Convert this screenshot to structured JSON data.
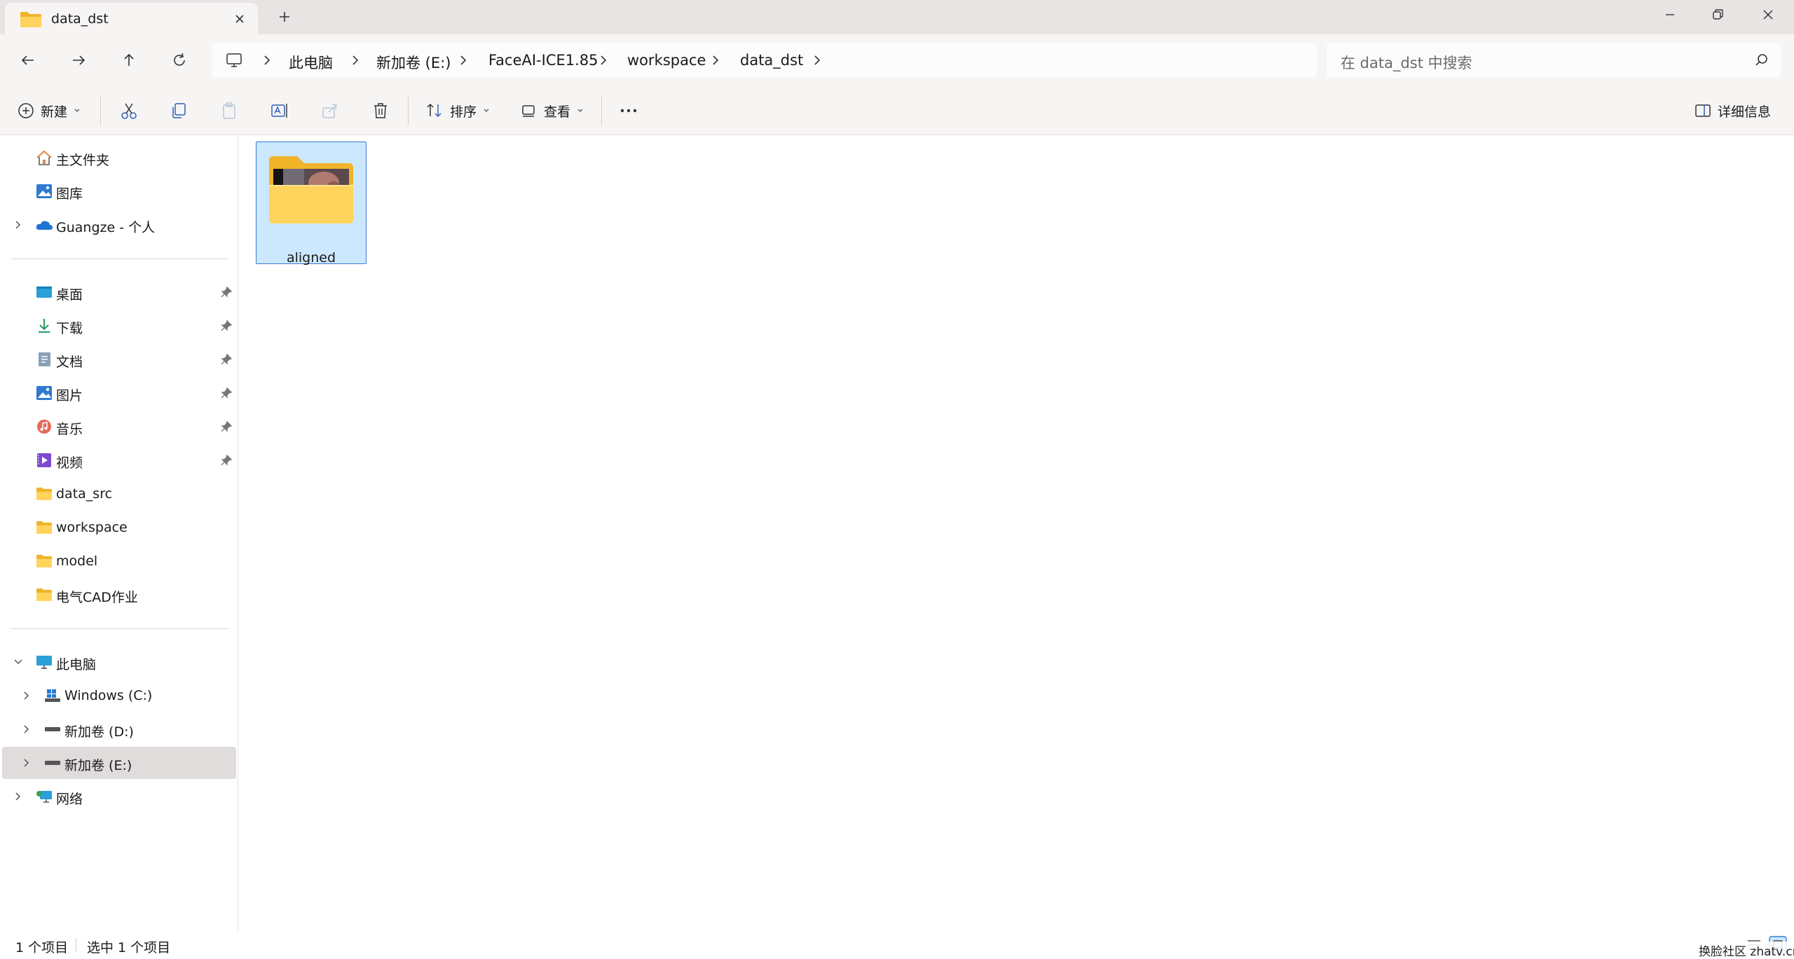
{
  "window": {
    "tab_title": "data_dst",
    "new_tab_symbol": "+",
    "accent_color": "#3b7bd1",
    "selected_bg": "#cce8ff"
  },
  "nav": {
    "breadcrumb": [
      "此电脑",
      "新加卷 (E:)",
      "FaceAI-ICE1.85",
      "workspace",
      "data_dst"
    ],
    "search_placeholder": "在 data_dst 中搜索"
  },
  "toolbar": {
    "new_label": "新建",
    "sort_label": "排序",
    "view_label": "查看",
    "more_label": "···",
    "details_label": "详细信息",
    "icons": [
      "cut-icon",
      "copy-icon",
      "paste-icon",
      "rename-icon",
      "share-icon",
      "delete-icon"
    ]
  },
  "sidebar": {
    "top": [
      {
        "label": "主文件夹",
        "icon": "home-icon"
      },
      {
        "label": "图库",
        "icon": "gallery-icon"
      },
      {
        "label": "Guangze - 个人",
        "icon": "onedrive-icon"
      }
    ],
    "quick_access": [
      {
        "label": "桌面",
        "icon": "desktop-icon",
        "pinned": true
      },
      {
        "label": "下载",
        "icon": "download-icon",
        "pinned": true
      },
      {
        "label": "文档",
        "icon": "document-icon",
        "pinned": true
      },
      {
        "label": "图片",
        "icon": "pictures-icon",
        "pinned": true
      },
      {
        "label": "音乐",
        "icon": "music-icon",
        "pinned": true
      },
      {
        "label": "视频",
        "icon": "video-icon",
        "pinned": true
      },
      {
        "label": "data_src",
        "icon": "folder-icon",
        "pinned": false
      },
      {
        "label": "workspace",
        "icon": "folder-icon",
        "pinned": false
      },
      {
        "label": "model",
        "icon": "folder-icon",
        "pinned": false
      },
      {
        "label": "电气CAD作业",
        "icon": "folder-icon",
        "pinned": false
      }
    ],
    "this_pc": {
      "label": "此电脑",
      "icon": "computer-icon"
    },
    "drives": [
      {
        "label": "Windows (C:)",
        "icon": "windows-drive-icon"
      },
      {
        "label": "新加卷 (D:)",
        "icon": "drive-icon"
      },
      {
        "label": "新加卷 (E:)",
        "icon": "drive-icon",
        "selected": true
      }
    ],
    "network": {
      "label": "网络",
      "icon": "network-icon"
    }
  },
  "content": {
    "items": [
      {
        "name": "aligned",
        "type": "folder",
        "selected": true
      }
    ]
  },
  "status": {
    "item_count": "1 个项目",
    "selected_count": "选中 1 个项目",
    "watermark": "换脸社区 zhatv.cn"
  }
}
